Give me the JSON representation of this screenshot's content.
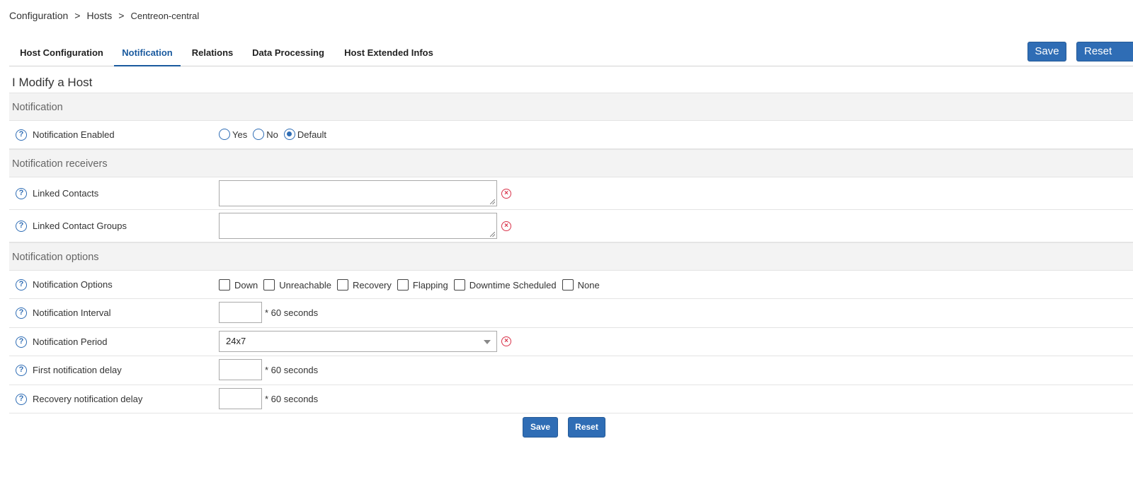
{
  "breadcrumb": [
    "Configuration",
    "Hosts",
    "Centreon-central"
  ],
  "breadcrumb_separator": ">",
  "tabs": [
    {
      "label": "Host Configuration"
    },
    {
      "label": "Notification"
    },
    {
      "label": "Relations"
    },
    {
      "label": "Data Processing"
    },
    {
      "label": "Host Extended Infos"
    }
  ],
  "active_tab": "Notification",
  "toolbar": {
    "save_label": "Save",
    "reset_label": "Reset"
  },
  "page_title": "I Modify a Host",
  "sections": {
    "notification": "Notification",
    "receivers": "Notification receivers",
    "options": "Notification options"
  },
  "fields": {
    "notification_enabled": {
      "label": "Notification Enabled",
      "options": [
        "Yes",
        "No",
        "Default"
      ],
      "selected": "Default"
    },
    "linked_contacts": {
      "label": "Linked Contacts",
      "value": ""
    },
    "linked_contact_groups": {
      "label": "Linked Contact Groups",
      "value": ""
    },
    "notification_options": {
      "label": "Notification Options",
      "options": [
        "Down",
        "Unreachable",
        "Recovery",
        "Flapping",
        "Downtime Scheduled",
        "None"
      ],
      "checked": []
    },
    "notification_interval": {
      "label": "Notification Interval",
      "value": "",
      "unit": "* 60 seconds"
    },
    "notification_period": {
      "label": "Notification Period",
      "value": "24x7"
    },
    "first_notification_delay": {
      "label": "First notification delay",
      "value": "",
      "unit": "* 60 seconds"
    },
    "recovery_notification_delay": {
      "label": "Recovery notification delay",
      "value": "",
      "unit": "* 60 seconds"
    }
  },
  "help_glyph": "?",
  "remove_glyph": "×",
  "footer": {
    "save_label": "Save",
    "reset_label": "Reset"
  },
  "icons": {
    "help": "help-circle-icon",
    "remove": "remove-circle-icon",
    "dropdown": "caret-down-icon"
  },
  "colors": {
    "accent": "#2f6db5",
    "remove": "#d9334a",
    "section_bg": "#f3f3f3"
  }
}
